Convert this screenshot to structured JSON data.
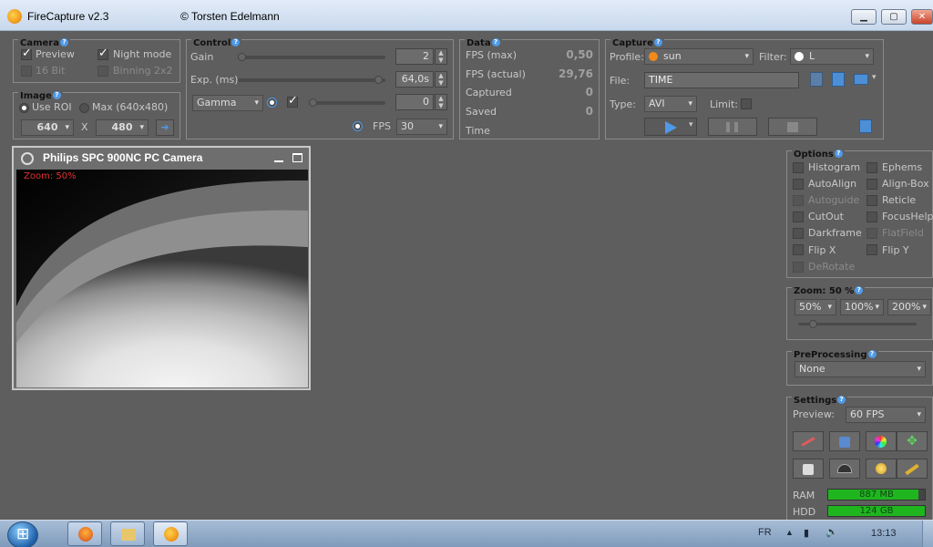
{
  "window": {
    "title": "FireCapture v2.3",
    "author": "© Torsten Edelmann",
    "min": "▁",
    "max": "▢",
    "close": "✕"
  },
  "camera_panel": {
    "title": "Camera",
    "preview": "Preview",
    "night_mode": "Night mode",
    "bit16": "16 Bit",
    "binning": "Binning 2x2"
  },
  "image_panel": {
    "title": "Image",
    "use_roi": "Use ROI",
    "max": "Max (640x480)",
    "width": "640",
    "x": "X",
    "height": "480"
  },
  "control_panel": {
    "title": "Control",
    "gain_label": "Gain",
    "gain_value": "2",
    "exp_label": "Exp. (ms)",
    "exp_value": "64,0s",
    "gamma_select": "Gamma",
    "gamma_value": "0",
    "fps_label": "FPS",
    "fps_select": "30"
  },
  "data_panel": {
    "title": "Data",
    "fps_max_label": "FPS (max)",
    "fps_max": "0,50",
    "fps_actual_label": "FPS (actual)",
    "fps_actual": "29,76",
    "captured_label": "Captured",
    "captured": "0",
    "saved_label": "Saved",
    "saved": "0",
    "time_label": "Time"
  },
  "capture_panel": {
    "title": "Capture",
    "profile_label": "Profile:",
    "profile_value": "sun",
    "filter_label": "Filter:",
    "filter_value": "L",
    "file_label": "File:",
    "file_value": "TIME",
    "type_label": "Type:",
    "type_value": "AVI",
    "limit_label": "Limit:"
  },
  "camera_window": {
    "title": "Philips SPC 900NC PC Camera",
    "zoom_text": "Zoom: 50%"
  },
  "options_panel": {
    "title": "Options",
    "left": [
      "Histogram",
      "AutoAlign",
      "Autoguide",
      "CutOut",
      "Darkframe",
      "Flip X",
      "DeRotate"
    ],
    "right": [
      "Ephems",
      "Align-Box",
      "Reticle",
      "FocusHelp",
      "FlatField",
      "Flip Y"
    ]
  },
  "zoom_panel": {
    "title": "Zoom: 50 %",
    "btn50": "50%",
    "btn100": "100%",
    "btn200": "200%"
  },
  "preprocessing_panel": {
    "title": "PreProcessing",
    "value": "None"
  },
  "settings_panel": {
    "title": "Settings",
    "preview_label": "Preview:",
    "preview_value": "60 FPS",
    "ram_label": "RAM",
    "ram_value": "887 MB",
    "hdd_label": "HDD",
    "hdd_value": "124 GB",
    "ram_level": 0.93,
    "hdd_level": 1.0
  },
  "taskbar": {
    "lang": "FR",
    "clock": "13:13"
  },
  "colors": {
    "accent": "#4f9ae8",
    "meter": "#1fb51f",
    "zoom_text": "#e23030"
  }
}
